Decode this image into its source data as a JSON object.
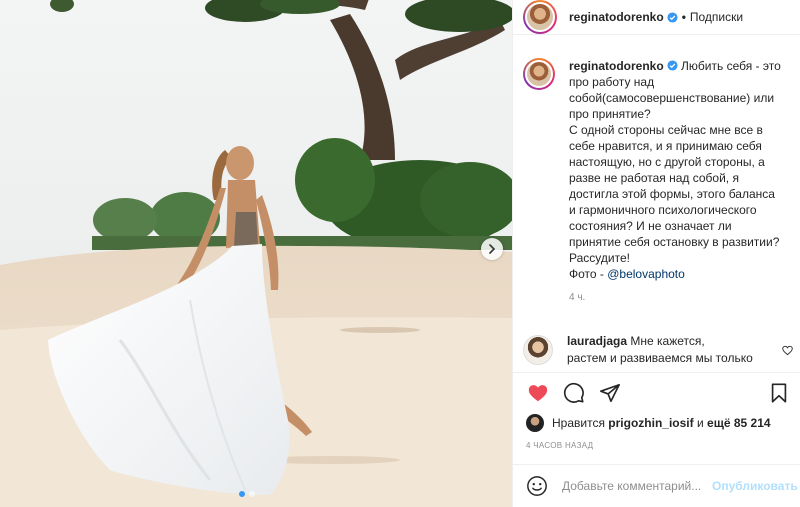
{
  "post": {
    "author": "reginatodorenko",
    "follow_label": "Подписки",
    "bullet": "•",
    "caption_lines": [
      "Любить себя - это",
      "про работу над",
      "собой(самосовершенствование) или",
      "про принятие?",
      "С одной стороны сейчас мне все в",
      "себе нравится, и я принимаю себя",
      "настоящую, но с другой стороны, а",
      "разве не работая над собой, я",
      "достигла этой формы, этого баланса",
      "и гармоничного психологического",
      "состояния? И не означает ли",
      "принятие себя остановку в развитии?",
      "Рассудите!"
    ],
    "photo_prefix": "Фото - ",
    "photo_mention": "@belovaphoto",
    "caption_time": "4 ч.",
    "posted_ago": "4 ЧАСОВ НАЗАД"
  },
  "reply": {
    "author": "lauradjaga",
    "text_line1": "Мне кажется,",
    "text_line2": "растем и развиваемся мы только"
  },
  "likes": {
    "prefix": "Нравится",
    "user": "prigozhin_iosif",
    "middle": "и",
    "rest": "ещё 85 214"
  },
  "comment_box": {
    "placeholder": "Добавьте комментарий...",
    "publish_label": "Опубликовать"
  },
  "carousel": {
    "slides": 2,
    "active": 0
  },
  "colors": {
    "like_red": "#ed4956",
    "link_blue": "#00376b",
    "verified_blue": "#3897f0",
    "publish_disabled": "#b2dffc",
    "muted": "#8e8e8e"
  },
  "icons": [
    "verified-icon",
    "heart-icon",
    "comment-icon",
    "share-icon",
    "bookmark-icon",
    "emoji-icon",
    "chevron-right-icon",
    "small-heart-icon"
  ]
}
